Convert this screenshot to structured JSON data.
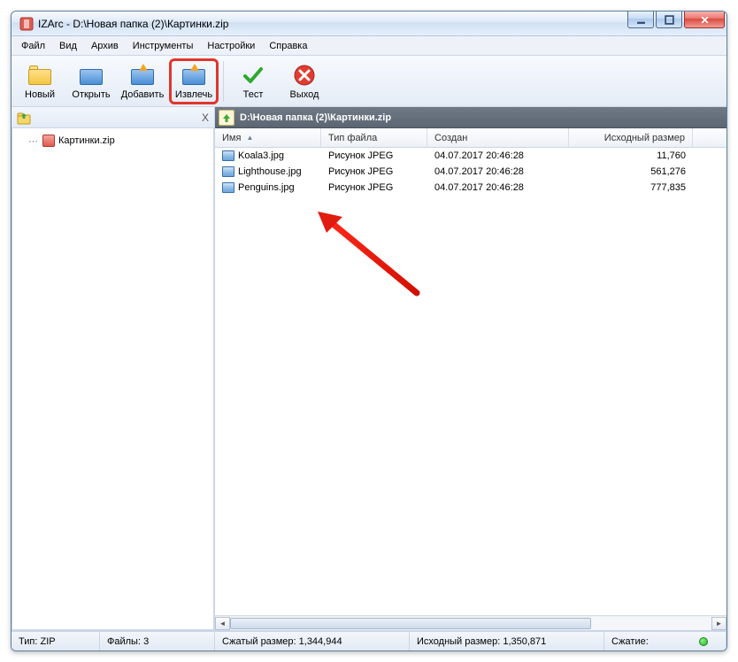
{
  "window": {
    "title": "IZArc - D:\\Новая папка (2)\\Картинки.zip"
  },
  "menu": {
    "file": "Файл",
    "view": "Вид",
    "archive": "Архив",
    "tools": "Инструменты",
    "settings": "Настройки",
    "help": "Справка"
  },
  "toolbar": {
    "new": "Новый",
    "open": "Открыть",
    "add": "Добавить",
    "extract": "Извлечь",
    "test": "Тест",
    "exit": "Выход"
  },
  "tree": {
    "close": "X",
    "root": "Картинки.zip"
  },
  "path": "D:\\Новая папка (2)\\Картинки.zip",
  "columns": {
    "name": "Имя",
    "type": "Тип файла",
    "created": "Создан",
    "size": "Исходный размер"
  },
  "files": [
    {
      "name": "Koala3.jpg",
      "type": "Рисунок JPEG",
      "created": "04.07.2017 20:46:28",
      "size": "11,760"
    },
    {
      "name": "Lighthouse.jpg",
      "type": "Рисунок JPEG",
      "created": "04.07.2017 20:46:28",
      "size": "561,276"
    },
    {
      "name": "Penguins.jpg",
      "type": "Рисунок JPEG",
      "created": "04.07.2017 20:46:28",
      "size": "777,835"
    }
  ],
  "status": {
    "type_label": "Тип:",
    "type_value": "ZIP",
    "files_label": "Файлы:",
    "files_value": "3",
    "packed_label": "Сжатый размер:",
    "packed_value": "1,344,944",
    "orig_label": "Исходный размер:",
    "orig_value": "1,350,871",
    "ratio_label": "Сжатие:"
  }
}
